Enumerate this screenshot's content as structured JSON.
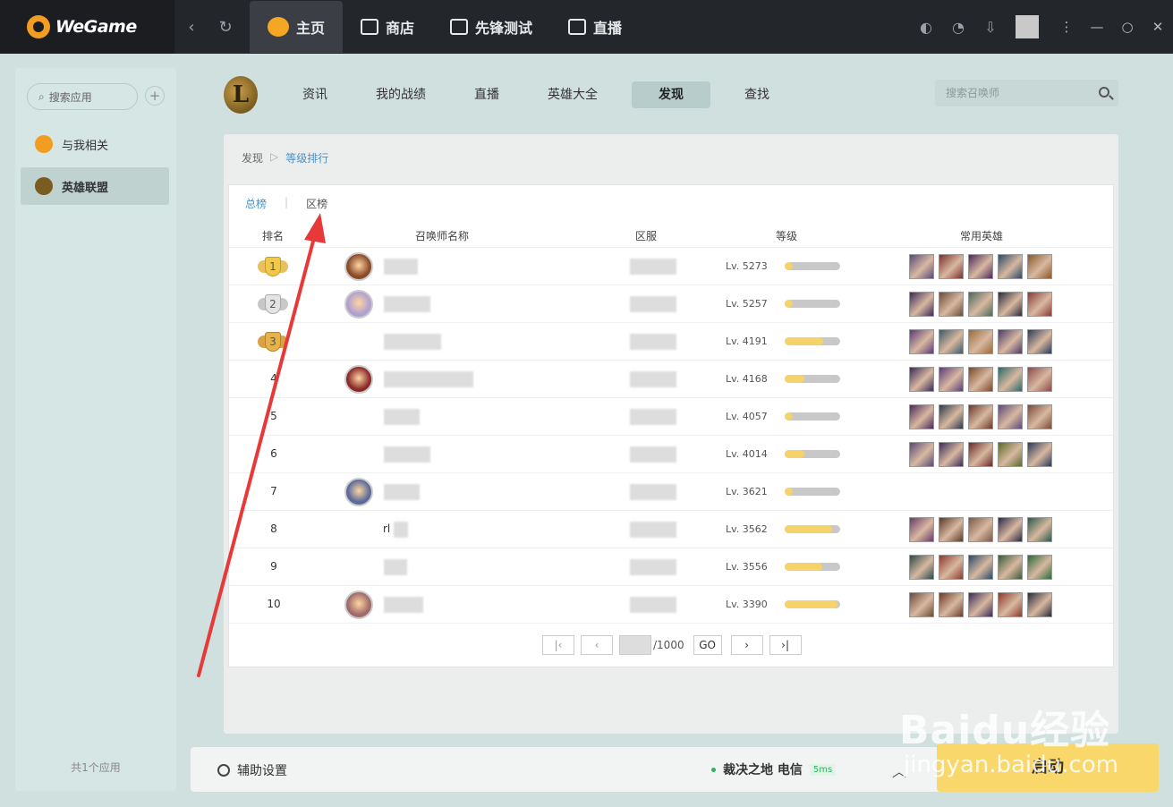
{
  "app": {
    "name": "WeGame"
  },
  "topnav": [
    {
      "label": "主页",
      "icon": "pacman-icon",
      "active": true
    },
    {
      "label": "商店",
      "icon": "bag-icon",
      "active": false
    },
    {
      "label": "先锋测试",
      "icon": "flask-icon",
      "active": false
    },
    {
      "label": "直播",
      "icon": "play-icon",
      "active": false
    }
  ],
  "sidebar": {
    "search_placeholder": "搜索应用",
    "items": [
      {
        "label": "与我相关"
      },
      {
        "label": "英雄联盟"
      }
    ],
    "footer": "共1个应用"
  },
  "game": {
    "tabs": [
      "资讯",
      "我的战绩",
      "直播",
      "英雄大全",
      "发现",
      "查找"
    ],
    "active_tab": "发现",
    "search_placeholder": "搜索召唤师"
  },
  "breadcrumb": {
    "root": "发现",
    "current": "等级排行"
  },
  "subtabs": {
    "total": "总榜",
    "region": "区榜"
  },
  "table": {
    "headers": {
      "rank": "排名",
      "name": "召唤师名称",
      "server": "区服",
      "level": "等级",
      "heroes": "常用英雄"
    },
    "rows": [
      {
        "rank": "1",
        "level": "Lv. 5273",
        "progress": 0.15,
        "name_prefix": ""
      },
      {
        "rank": "2",
        "level": "Lv. 5257",
        "progress": 0.15,
        "name_prefix": ""
      },
      {
        "rank": "3",
        "level": "Lv. 4191",
        "progress": 0.7,
        "name_prefix": ""
      },
      {
        "rank": "4",
        "level": "Lv. 4168",
        "progress": 0.35,
        "name_prefix": ""
      },
      {
        "rank": "5",
        "level": "Lv. 4057",
        "progress": 0.15,
        "name_prefix": ""
      },
      {
        "rank": "6",
        "level": "Lv. 4014",
        "progress": 0.35,
        "name_prefix": ""
      },
      {
        "rank": "7",
        "level": "Lv. 3621",
        "progress": 0.15,
        "name_prefix": ""
      },
      {
        "rank": "8",
        "level": "Lv. 3562",
        "progress": 0.85,
        "name_prefix": "rl"
      },
      {
        "rank": "9",
        "level": "Lv. 3556",
        "progress": 0.68,
        "name_prefix": ""
      },
      {
        "rank": "10",
        "level": "Lv. 3390",
        "progress": 0.95,
        "name_prefix": ""
      }
    ]
  },
  "pager": {
    "total": "/1000",
    "go": "GO"
  },
  "bottom": {
    "assist": "辅助设置",
    "server": "裁决之地 电信",
    "ping": "5ms",
    "launch": "启动"
  },
  "watermark": {
    "main": "Baidu经验",
    "sub": "jingyan.baidu.com"
  },
  "colors": {
    "accent": "#f9d76a",
    "link": "#4a90c8",
    "arrow": "#e8393a"
  }
}
